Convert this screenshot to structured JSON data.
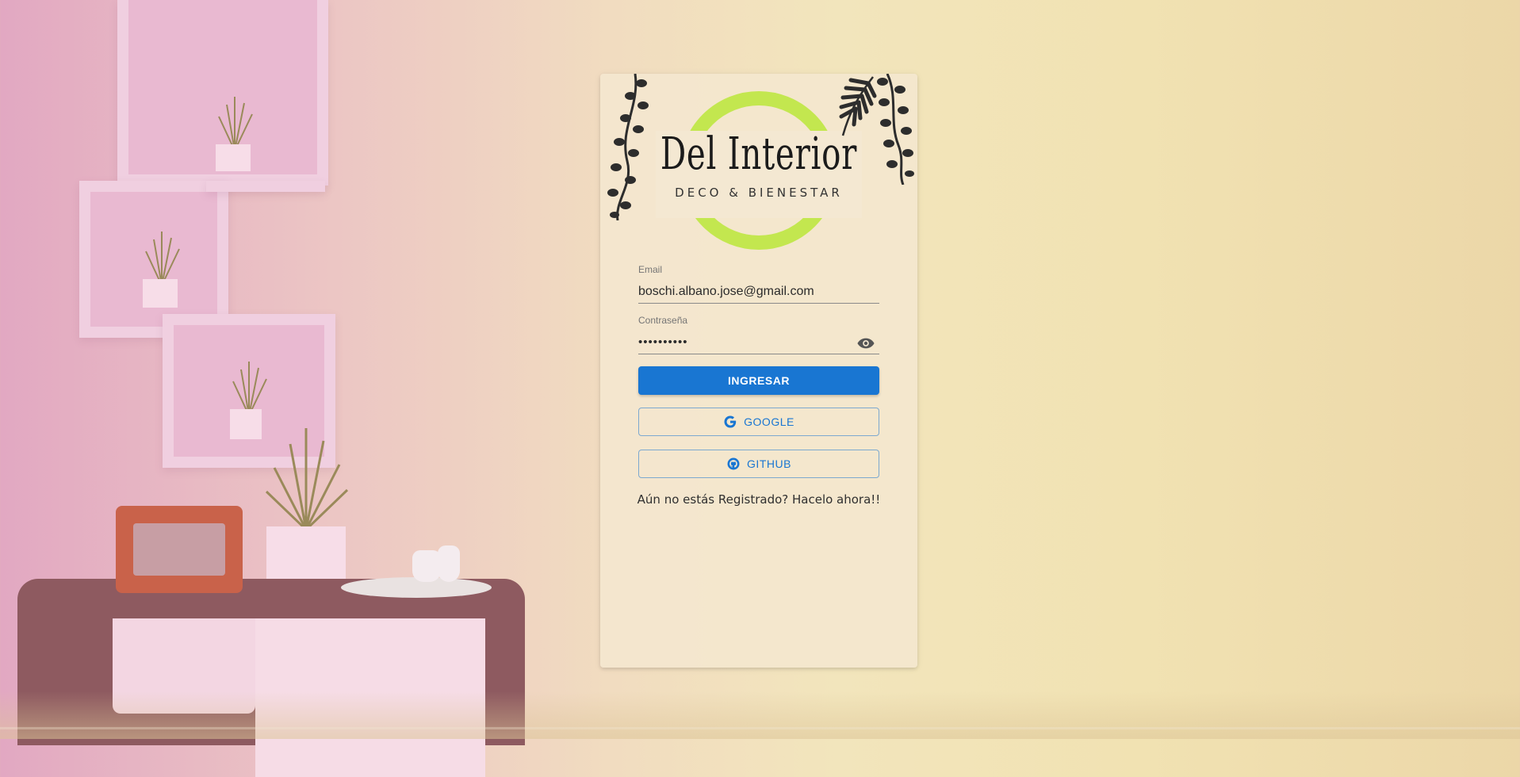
{
  "brand": {
    "title": "Del Interior",
    "subtitle": "DECO & BIENESTAR"
  },
  "form": {
    "email": {
      "label": "Email",
      "value": "boschi.albano.jose@gmail.com"
    },
    "password": {
      "label": "Contraseña",
      "value": "••••••••••"
    }
  },
  "buttons": {
    "login": "INGRESAR",
    "google": "GOOGLE",
    "github": "GITHUB"
  },
  "register_link": "Aún no estás Registrado? Hacelo ahora!!",
  "colors": {
    "primary": "#1976d2",
    "logo_ring": "#c3e74f",
    "card_bg": "#f5e8d0"
  },
  "icons": {
    "password_toggle": "eye-icon",
    "google": "google-icon",
    "github": "github-icon"
  }
}
